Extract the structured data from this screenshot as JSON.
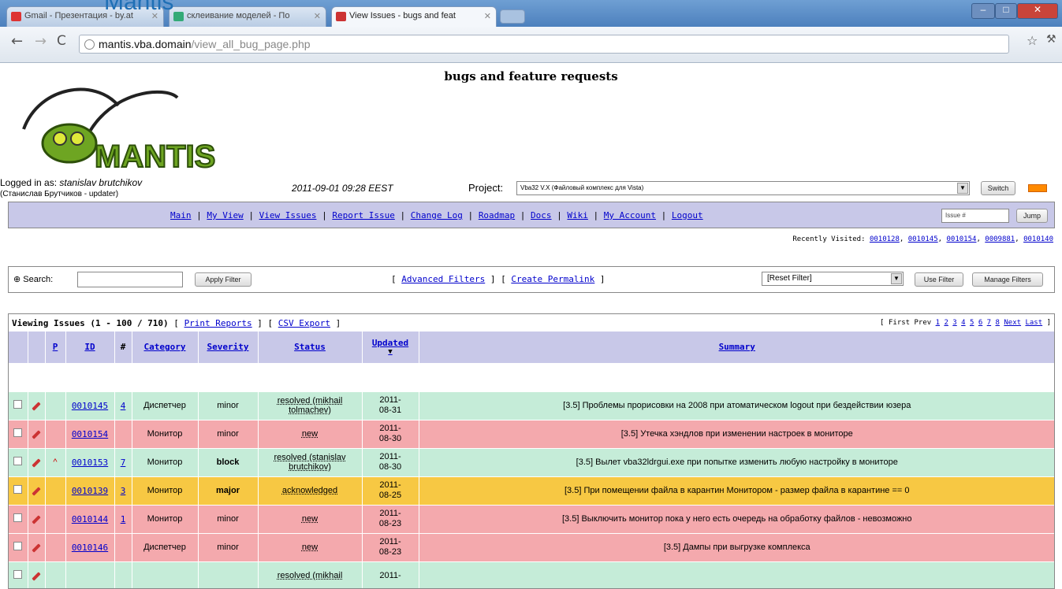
{
  "slide_caption": "Mantis",
  "browser": {
    "tabs": [
      {
        "label": "Gmail - Презентaция - by.at",
        "icon_color": "#d33"
      },
      {
        "label": "склеивание моделей - По",
        "icon_color": "#3a7"
      },
      {
        "label": "View Issues - bugs and feat",
        "icon_color": "#c33"
      }
    ],
    "url_host": "mantis.vba.domain",
    "url_path": "/view_all_bug_page.php",
    "star_icon": "star-icon",
    "wrench_icon": "wrench-icon"
  },
  "page": {
    "title": "bugs and feature requests",
    "logo_text": "MANTIS",
    "login_prefix": "Logged in as: ",
    "login_user": "stanislav brutchikov",
    "login_sub": "(Станислав Брутчиков - updater)",
    "datetime": "2011-09-01 09:28 EEST",
    "project_label": "Project:",
    "project_value": "Vba32 V.X (Файловый комплекс для Vista)",
    "switch_label": "Switch",
    "menu": [
      "Main",
      "My View",
      "View Issues",
      "Report Issue",
      "Change Log",
      "Roadmap",
      "Docs",
      "Wiki",
      "My Account",
      "Logout"
    ],
    "issue_placeholder": "Issue #",
    "jump_label": "Jump",
    "recent_label": "Recently Visited:",
    "recent": [
      "0010128",
      "0010145",
      "0010154",
      "0009881",
      "0010140"
    ],
    "search_label": "Search:",
    "apply_filter": "Apply Filter",
    "advanced_filters": "Advanced Filters",
    "create_permalink": "Create Permalink",
    "reset_filter": "[Reset Filter]",
    "use_filter": "Use Filter",
    "manage_filters": "Manage Filters",
    "viewing_issues": "Viewing Issues (1 - 100 / 710)",
    "print_reports": "Print Reports",
    "csv_export": "CSV Export",
    "pager_prefix": "[ First Prev",
    "pager_pages": [
      "1",
      "2",
      "3",
      "4",
      "5",
      "6",
      "7",
      "8"
    ],
    "pager_next": "Next",
    "pager_last": "Last",
    "pager_suffix": "]"
  },
  "columns": [
    "P",
    "ID",
    "#",
    "Category",
    "Severity",
    "Status",
    "Updated",
    "Summary"
  ],
  "rows": [
    {
      "color": "green",
      "priority": "",
      "id": "0010145",
      "notes": "4",
      "category": "Диспетчер",
      "severity": "minor",
      "sev_bold": false,
      "status": "resolved (mikhail tolmachev)",
      "updated1": "2011-",
      "updated2": "08-31",
      "summary": "[3.5] Проблемы прорисовки на 2008 при атоматическом logout при бездействии юзера"
    },
    {
      "color": "red",
      "priority": "",
      "id": "0010154",
      "notes": "",
      "category": "Монитор",
      "severity": "minor",
      "sev_bold": false,
      "status": "new",
      "updated1": "2011-",
      "updated2": "08-30",
      "summary": "[3.5] Утечка хэндлов при изменении настроек в мониторе"
    },
    {
      "color": "green",
      "priority": "^",
      "id": "0010153",
      "notes": "7",
      "category": "Монитор",
      "severity": "block",
      "sev_bold": true,
      "status": "resolved (stanislav brutchikov)",
      "updated1": "2011-",
      "updated2": "08-30",
      "summary": "[3.5] Вылет vba32ldrgui.exe при попытке изменить любую настройку в мониторе"
    },
    {
      "color": "orange",
      "priority": "",
      "id": "0010139",
      "notes": "3",
      "category": "Монитор",
      "severity": "major",
      "sev_bold": true,
      "status": "acknowledged",
      "updated1": "2011-",
      "updated2": "08-25",
      "summary": "[3.5] При помещении файла в карантин Монитором - размер файла в карантине == 0"
    },
    {
      "color": "red",
      "priority": "",
      "id": "0010144",
      "notes": "1",
      "category": "Монитор",
      "severity": "minor",
      "sev_bold": false,
      "status": "new",
      "updated1": "2011-",
      "updated2": "08-23",
      "summary": "[3.5] Выключить монитор пока у него есть очередь на обработку файлов - невозможно"
    },
    {
      "color": "red",
      "priority": "",
      "id": "0010146",
      "notes": "",
      "category": "Диспетчер",
      "severity": "minor",
      "sev_bold": false,
      "status": "new",
      "updated1": "2011-",
      "updated2": "08-23",
      "summary": "[3.5] Дампы при выгрузке комплекса"
    },
    {
      "color": "green",
      "priority": "",
      "id": "",
      "notes": "",
      "category": "",
      "severity": "",
      "sev_bold": false,
      "status": "resolved (mikhail",
      "updated1": "2011-",
      "updated2": "",
      "summary": ""
    }
  ]
}
